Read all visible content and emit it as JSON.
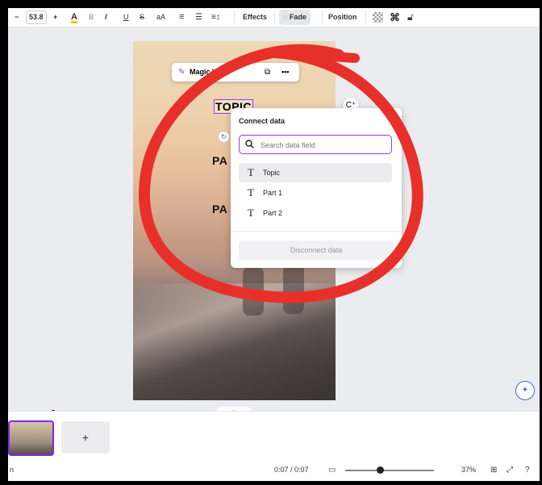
{
  "toolbar": {
    "font_size": "53.8",
    "minus": "−",
    "plus": "+",
    "color_label": "A",
    "bold": "B",
    "italic": "I",
    "underline": "U",
    "strike": "S",
    "case": "aA",
    "align_icon": "≡",
    "list_icon": "☰",
    "spacing_icon": "≡↕",
    "effects": "Effects",
    "fade": "Fade",
    "position": "Position"
  },
  "floatbar": {
    "magic_write": "Magic Write",
    "more": "•••"
  },
  "canvas": {
    "topic": "TOPIC",
    "part1": "PA",
    "part2": "PA"
  },
  "connect_data": {
    "title": "Connect data",
    "search_placeholder": "Search data field",
    "fields": [
      {
        "label": "Topic",
        "selected": true
      },
      {
        "label": "Part 1",
        "selected": false
      },
      {
        "label": "Part 2",
        "selected": false
      }
    ],
    "disconnect": "Disconnect data"
  },
  "pages": {
    "add": "+"
  },
  "status": {
    "time": "0:07 / 0:07",
    "zoom": "37%",
    "zoom_level": 0.37,
    "left_label": "n"
  },
  "colors": {
    "accent": "#8b3dff",
    "annotation": "#e8302a",
    "text_color_bar": "#f5c518"
  }
}
